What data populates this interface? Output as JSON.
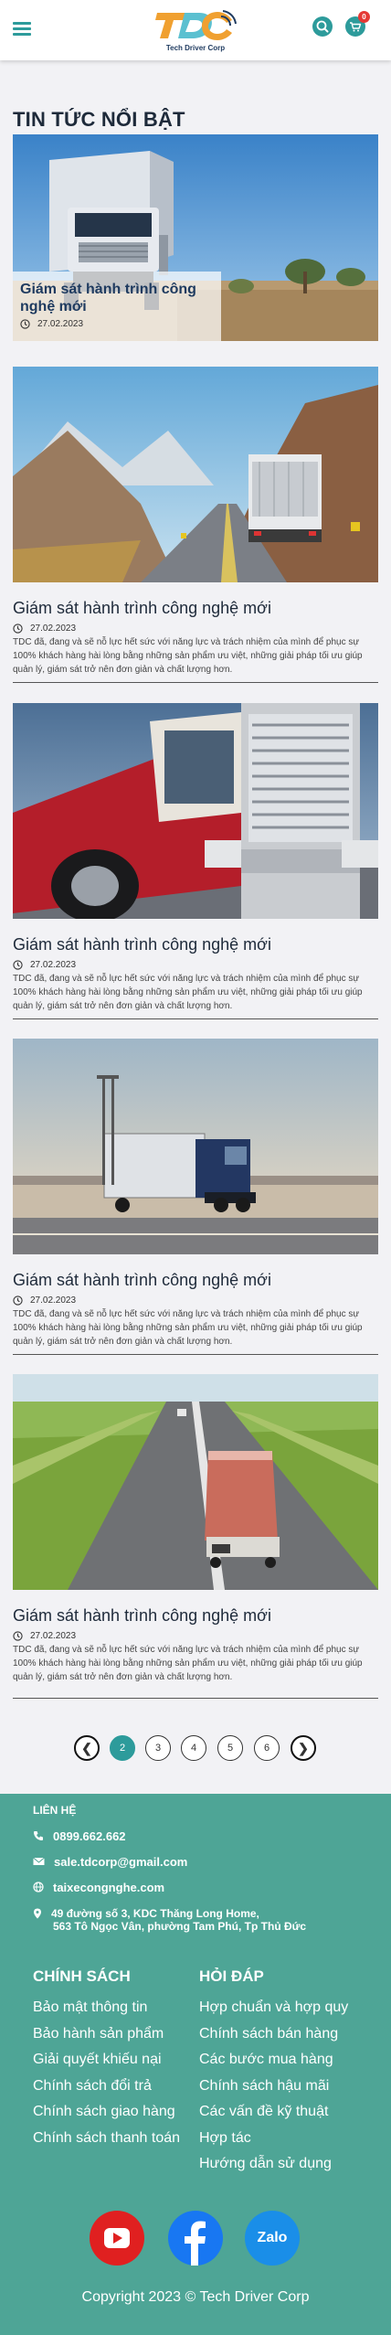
{
  "header": {
    "brand": "Tech Driver Corp",
    "logo_letters": "TDC",
    "cart_count": "0",
    "menu_icon": "hamburger-icon",
    "search_icon": "search-icon",
    "cart_icon": "cart-icon"
  },
  "section_title": "TIN TỨC NỔI BẬT",
  "featured": {
    "title": "Giám sát hành trình công nghệ mới",
    "date": "27.02.2023"
  },
  "news": [
    {
      "title": "Giám sát hành trình công nghệ mới",
      "date": "27.02.2023",
      "desc": "TDC đã, đang và sẽ nỗ lực hết sức với năng lực và trách nhiệm của mình để phục sự 100% khách hàng hài lòng bằng những sản phẩm ưu việt, những giải pháp tối ưu giúp quản lý, giám sát trở nên  đơn giản và chất lượng hơn."
    },
    {
      "title": "Giám sát hành trình công nghệ mới",
      "date": "27.02.2023",
      "desc": "TDC đã, đang và sẽ nỗ lực hết sức với năng lực và trách nhiệm của mình để phục sự 100% khách hàng hài lòng bằng những sản phẩm ưu việt, những giải pháp tối ưu giúp quản lý, giám sát trở nên  đơn giản và chất lượng hơn."
    },
    {
      "title": "Giám sát hành trình công nghệ mới",
      "date": "27.02.2023",
      "desc": "TDC đã, đang và sẽ nỗ lực hết sức với năng lực và trách nhiệm của mình để phục sự 100% khách hàng hài lòng bằng những sản phẩm ưu việt, những giải pháp tối ưu giúp quản lý, giám sát trở nên  đơn giản và chất lượng hơn."
    },
    {
      "title": "Giám sát hành trình công nghệ mới",
      "date": "27.02.2023",
      "desc": "TDC đã, đang và sẽ nỗ lực hết sức với năng lực và trách nhiệm của mình để phục sự 100% khách hàng hài lòng bằng những sản phẩm ưu việt, những giải pháp tối ưu giúp quản lý, giám sát trở nên  đơn giản và chất lượng hơn."
    }
  ],
  "pagination": {
    "prev": "❮",
    "next": "❯",
    "pages": [
      "2",
      "3",
      "4",
      "5",
      "6"
    ],
    "current": "2"
  },
  "footer": {
    "contact_heading": "LIÊN HỆ",
    "phone": "0899.662.662",
    "email": "sale.tdcorp@gmail.com",
    "website": "taixecongnghe.com",
    "address_line1": "49 đường số 3, KDC Thăng Long Home,",
    "address_line2": "563 Tô Ngọc Vân, phường Tam Phú, Tp Thủ Đức",
    "policy_heading": "CHÍNH SÁCH",
    "policy_items": [
      "Bảo mật thông tin",
      "Bảo hành sản phẩm",
      "Giải quyết khiếu nại",
      "Chính sách đổi trả",
      "Chính sách giao hàng",
      "Chính sách thanh toán"
    ],
    "faq_heading": "HỎI ĐÁP",
    "faq_items": [
      "Hợp chuẩn và hợp quy",
      "Chính sách bán hàng",
      "Các bước mua hàng",
      "Chính sách hậu mãi",
      "Các vấn đề kỹ thuật",
      "Hợp tác",
      "Hướng dẫn sử dụng"
    ],
    "social": {
      "youtube_icon": "youtube-icon",
      "facebook_icon": "facebook-icon",
      "zalo_label": "Zalo"
    },
    "copyright": "Copyright 2023 © Tech Driver Corp"
  },
  "colors": {
    "accent": "#2d9b9b",
    "footer_bg": "#4ea596",
    "logo_orange": "#f0a030",
    "logo_teal": "#5bc0d0",
    "youtube_red": "#e02020",
    "facebook_blue": "#1877f2",
    "zalo_blue": "#1a8ee8"
  }
}
